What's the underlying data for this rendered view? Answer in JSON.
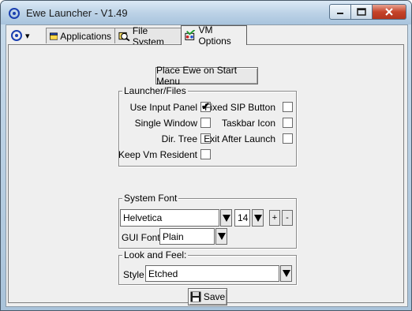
{
  "window": {
    "title": "Ewe Launcher - V1.49",
    "controls": {
      "minimize": "minimize-icon",
      "maximize": "maximize-icon",
      "close": "close-icon"
    }
  },
  "menu": {
    "icon": "ewe-app-icon",
    "arrow": "▾"
  },
  "tabs": [
    {
      "label": "Applications",
      "icon": "applications-window-icon",
      "active": false
    },
    {
      "label": "File System",
      "icon": "file-system-magnifier-icon",
      "active": false
    },
    {
      "label": "VM Options",
      "icon": "vm-options-icon",
      "active": true
    }
  ],
  "vm_options": {
    "start_menu_button": "Place Ewe on Start Menu",
    "launcher_files": {
      "title": "Launcher/Files",
      "options": [
        {
          "label": "Use Input Panel",
          "checked": true
        },
        {
          "label": "Fixed SIP Button",
          "checked": false
        },
        {
          "label": "Single Window",
          "checked": false
        },
        {
          "label": "Taskbar Icon",
          "checked": false
        },
        {
          "label": "Dir. Tree",
          "checked": false
        },
        {
          "label": "Exit After Launch",
          "checked": false
        },
        {
          "label": "Keep Vm Resident",
          "checked": false
        }
      ]
    },
    "system_font": {
      "title": "System Font",
      "font_name": "Helvetica",
      "font_size": "14",
      "increase_label": "+",
      "decrease_label": "-",
      "gui_font_label": "GUI Font:",
      "gui_font_value": "Plain"
    },
    "look_and_feel": {
      "title": "Look and Feel:",
      "style_label": "Style",
      "style_value": "Etched"
    },
    "save_button": "Save",
    "check_mark": "✔"
  },
  "colors": {
    "titlebar": "#bdd3e7",
    "client_bg": "#efefef",
    "close_button": "#c6442a"
  }
}
